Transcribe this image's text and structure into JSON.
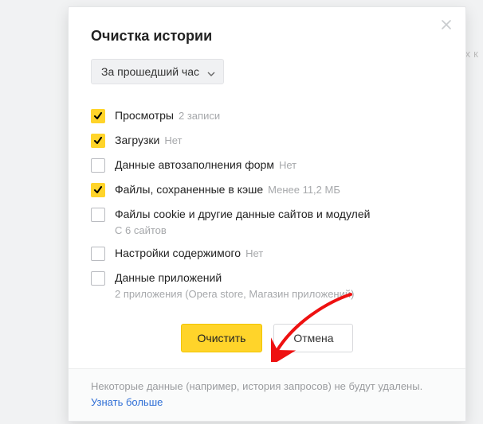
{
  "bg_text": "нтовых к",
  "dialog": {
    "title": "Очистка истории",
    "period_label": "За прошедший час",
    "options": [
      {
        "label": "Просмотры",
        "hint": "2 записи",
        "sub": "",
        "checked": true
      },
      {
        "label": "Загрузки",
        "hint": "Нет",
        "sub": "",
        "checked": true
      },
      {
        "label": "Данные автозаполнения форм",
        "hint": "Нет",
        "sub": "",
        "checked": false
      },
      {
        "label": "Файлы, сохраненные в кэше",
        "hint": "Менее 11,2 МБ",
        "sub": "",
        "checked": true
      },
      {
        "label": "Файлы cookie и другие данные сайтов и модулей",
        "hint": "",
        "sub": "С 6 сайтов",
        "checked": false
      },
      {
        "label": "Настройки содержимого",
        "hint": "Нет",
        "sub": "",
        "checked": false
      },
      {
        "label": "Данные приложений",
        "hint": "",
        "sub": "2 приложения (Opera store, Магазин приложений)",
        "checked": false
      }
    ],
    "clear_button": "Очистить",
    "cancel_button": "Отмена",
    "footer_note": "Некоторые данные (например, история запросов) не будут удалены.",
    "learn_more": "Узнать больше"
  }
}
